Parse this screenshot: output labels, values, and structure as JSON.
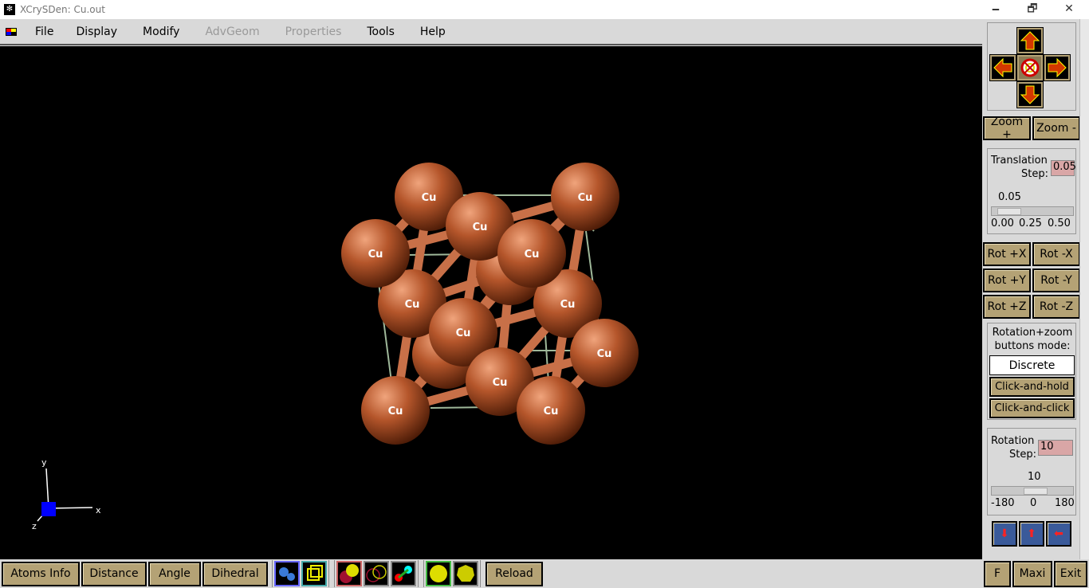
{
  "window": {
    "title": "XCrySDen: Cu.out",
    "minimize": "🗕",
    "restore": "🗗",
    "close": "✕"
  },
  "menu": [
    "File",
    "Display",
    "Modify",
    "AdvGeom",
    "Properties",
    "Tools",
    "Help"
  ],
  "menu_disabled": [
    false,
    false,
    false,
    true,
    true,
    false,
    false
  ],
  "structure": {
    "atom_label": "Cu",
    "atom_color": "#b5562b",
    "bond_color": "#c87048",
    "cell_color": "#9fb89a"
  },
  "axes": {
    "x": "x",
    "y": "y",
    "z": "z"
  },
  "bottom": {
    "atoms_info": "Atoms Info",
    "distance": "Distance",
    "angle": "Angle",
    "dihedral": "Dihedral",
    "reload": "Reload"
  },
  "right": {
    "zoom_plus": "Zoom +",
    "zoom_minus": "Zoom -",
    "translation_label_1": "Translation",
    "translation_label_2": "Step:",
    "translation_value": "0.05",
    "translation_slider_value": "0.05",
    "translation_ticks": [
      "0.00",
      "0.25",
      "0.50"
    ],
    "rot": [
      "Rot +X",
      "Rot -X",
      "Rot +Y",
      "Rot -Y",
      "Rot +Z",
      "Rot -Z"
    ],
    "mode_label_1": "Rotation+zoom",
    "mode_label_2": "buttons mode:",
    "mode_discrete": "Discrete",
    "mode_hold": "Click-and-hold",
    "mode_click": "Click-and-click",
    "rotation_label_1": "Rotation",
    "rotation_label_2": "Step:",
    "rotation_value": "10",
    "rotation_slider_value": "10",
    "rotation_ticks": [
      "-180",
      "0",
      "180"
    ],
    "f": "F",
    "maxi": "Maxi",
    "exit": "Exit"
  }
}
